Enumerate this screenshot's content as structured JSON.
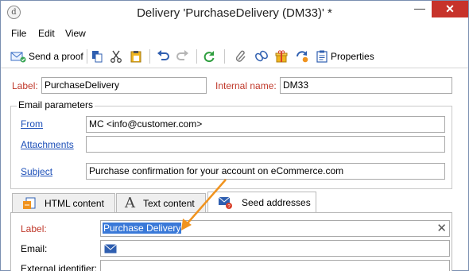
{
  "window": {
    "title": "Delivery 'PurchaseDelivery (DM33)' *",
    "app_icon_glyph": "d",
    "minimize_glyph": "—",
    "close_glyph": "✕"
  },
  "menu": {
    "file": "File",
    "edit": "Edit",
    "view": "View"
  },
  "toolbar": {
    "send_proof": "Send a proof",
    "properties": "Properties",
    "icons": [
      "send-proof-icon",
      "copy-icon",
      "cut-icon",
      "paste-icon",
      "undo-icon",
      "redo-icon",
      "refresh-icon",
      "link-icon",
      "unlink-icon",
      "gift-icon",
      "personalization-icon",
      "properties-icon"
    ]
  },
  "form": {
    "label_caption": "Label:",
    "label_value": "PurchaseDelivery",
    "internal_name_caption": "Internal name:",
    "internal_name_value": "DM33",
    "email_params_title": "Email parameters",
    "from_caption": "From",
    "from_value": "MC <info@customer.com>",
    "attachments_caption": "Attachments",
    "attachments_value": "",
    "subject_caption": "Subject",
    "subject_value": "Purchase confirmation for your account on eCommerce.com"
  },
  "tabs": [
    {
      "label": "HTML content",
      "icon": "html-content-icon",
      "active": false
    },
    {
      "label": "Text content",
      "icon": "text-content-icon",
      "active": false
    },
    {
      "label": "Seed addresses",
      "icon": "seed-addresses-icon",
      "active": true
    }
  ],
  "seed_panel": {
    "label_caption": "Label:",
    "label_value": "Purchase Delivery",
    "email_caption": "Email:",
    "email_value": "",
    "external_id_caption": "External identifier:",
    "external_id_value": "",
    "clear_glyph": "✕"
  },
  "colors": {
    "required_label": "#c0392b",
    "link": "#1c4fb8",
    "selection": "#3a79d8",
    "close_button": "#c7332b",
    "annotation_arrow": "#f0931e"
  }
}
